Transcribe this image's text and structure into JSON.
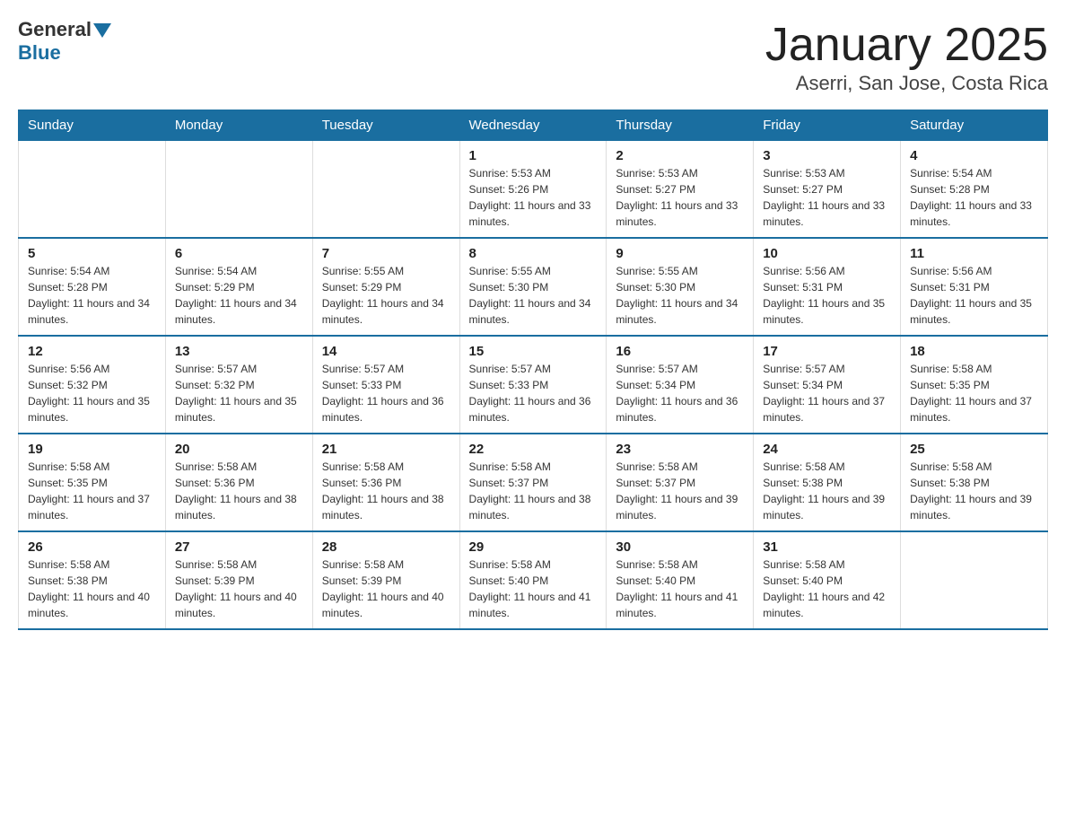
{
  "header": {
    "logo_general": "General",
    "logo_blue": "Blue",
    "month_title": "January 2025",
    "location": "Aserri, San Jose, Costa Rica"
  },
  "days_of_week": [
    "Sunday",
    "Monday",
    "Tuesday",
    "Wednesday",
    "Thursday",
    "Friday",
    "Saturday"
  ],
  "weeks": [
    [
      {
        "day": "",
        "info": ""
      },
      {
        "day": "",
        "info": ""
      },
      {
        "day": "",
        "info": ""
      },
      {
        "day": "1",
        "info": "Sunrise: 5:53 AM\nSunset: 5:26 PM\nDaylight: 11 hours and 33 minutes."
      },
      {
        "day": "2",
        "info": "Sunrise: 5:53 AM\nSunset: 5:27 PM\nDaylight: 11 hours and 33 minutes."
      },
      {
        "day": "3",
        "info": "Sunrise: 5:53 AM\nSunset: 5:27 PM\nDaylight: 11 hours and 33 minutes."
      },
      {
        "day": "4",
        "info": "Sunrise: 5:54 AM\nSunset: 5:28 PM\nDaylight: 11 hours and 33 minutes."
      }
    ],
    [
      {
        "day": "5",
        "info": "Sunrise: 5:54 AM\nSunset: 5:28 PM\nDaylight: 11 hours and 34 minutes."
      },
      {
        "day": "6",
        "info": "Sunrise: 5:54 AM\nSunset: 5:29 PM\nDaylight: 11 hours and 34 minutes."
      },
      {
        "day": "7",
        "info": "Sunrise: 5:55 AM\nSunset: 5:29 PM\nDaylight: 11 hours and 34 minutes."
      },
      {
        "day": "8",
        "info": "Sunrise: 5:55 AM\nSunset: 5:30 PM\nDaylight: 11 hours and 34 minutes."
      },
      {
        "day": "9",
        "info": "Sunrise: 5:55 AM\nSunset: 5:30 PM\nDaylight: 11 hours and 34 minutes."
      },
      {
        "day": "10",
        "info": "Sunrise: 5:56 AM\nSunset: 5:31 PM\nDaylight: 11 hours and 35 minutes."
      },
      {
        "day": "11",
        "info": "Sunrise: 5:56 AM\nSunset: 5:31 PM\nDaylight: 11 hours and 35 minutes."
      }
    ],
    [
      {
        "day": "12",
        "info": "Sunrise: 5:56 AM\nSunset: 5:32 PM\nDaylight: 11 hours and 35 minutes."
      },
      {
        "day": "13",
        "info": "Sunrise: 5:57 AM\nSunset: 5:32 PM\nDaylight: 11 hours and 35 minutes."
      },
      {
        "day": "14",
        "info": "Sunrise: 5:57 AM\nSunset: 5:33 PM\nDaylight: 11 hours and 36 minutes."
      },
      {
        "day": "15",
        "info": "Sunrise: 5:57 AM\nSunset: 5:33 PM\nDaylight: 11 hours and 36 minutes."
      },
      {
        "day": "16",
        "info": "Sunrise: 5:57 AM\nSunset: 5:34 PM\nDaylight: 11 hours and 36 minutes."
      },
      {
        "day": "17",
        "info": "Sunrise: 5:57 AM\nSunset: 5:34 PM\nDaylight: 11 hours and 37 minutes."
      },
      {
        "day": "18",
        "info": "Sunrise: 5:58 AM\nSunset: 5:35 PM\nDaylight: 11 hours and 37 minutes."
      }
    ],
    [
      {
        "day": "19",
        "info": "Sunrise: 5:58 AM\nSunset: 5:35 PM\nDaylight: 11 hours and 37 minutes."
      },
      {
        "day": "20",
        "info": "Sunrise: 5:58 AM\nSunset: 5:36 PM\nDaylight: 11 hours and 38 minutes."
      },
      {
        "day": "21",
        "info": "Sunrise: 5:58 AM\nSunset: 5:36 PM\nDaylight: 11 hours and 38 minutes."
      },
      {
        "day": "22",
        "info": "Sunrise: 5:58 AM\nSunset: 5:37 PM\nDaylight: 11 hours and 38 minutes."
      },
      {
        "day": "23",
        "info": "Sunrise: 5:58 AM\nSunset: 5:37 PM\nDaylight: 11 hours and 39 minutes."
      },
      {
        "day": "24",
        "info": "Sunrise: 5:58 AM\nSunset: 5:38 PM\nDaylight: 11 hours and 39 minutes."
      },
      {
        "day": "25",
        "info": "Sunrise: 5:58 AM\nSunset: 5:38 PM\nDaylight: 11 hours and 39 minutes."
      }
    ],
    [
      {
        "day": "26",
        "info": "Sunrise: 5:58 AM\nSunset: 5:38 PM\nDaylight: 11 hours and 40 minutes."
      },
      {
        "day": "27",
        "info": "Sunrise: 5:58 AM\nSunset: 5:39 PM\nDaylight: 11 hours and 40 minutes."
      },
      {
        "day": "28",
        "info": "Sunrise: 5:58 AM\nSunset: 5:39 PM\nDaylight: 11 hours and 40 minutes."
      },
      {
        "day": "29",
        "info": "Sunrise: 5:58 AM\nSunset: 5:40 PM\nDaylight: 11 hours and 41 minutes."
      },
      {
        "day": "30",
        "info": "Sunrise: 5:58 AM\nSunset: 5:40 PM\nDaylight: 11 hours and 41 minutes."
      },
      {
        "day": "31",
        "info": "Sunrise: 5:58 AM\nSunset: 5:40 PM\nDaylight: 11 hours and 42 minutes."
      },
      {
        "day": "",
        "info": ""
      }
    ]
  ]
}
